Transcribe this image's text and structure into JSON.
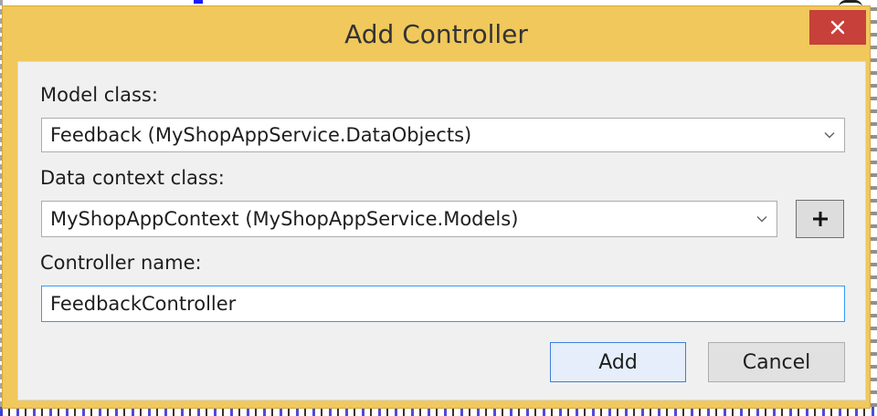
{
  "window": {
    "title": "Add Controller",
    "close_icon": "close-icon"
  },
  "form": {
    "model_class": {
      "label": "Model class:",
      "value": "Feedback (MyShopAppService.DataObjects)"
    },
    "data_context_class": {
      "label": "Data context class:",
      "value": "MyShopAppContext (MyShopAppService.Models)",
      "add_icon": "plus-icon"
    },
    "controller_name": {
      "label": "Controller name:",
      "value": "FeedbackController"
    }
  },
  "buttons": {
    "add_label": "Add",
    "cancel_label": "Cancel"
  },
  "colors": {
    "title_bar": "#f0c85c",
    "close_button": "#c7403a",
    "focus_border": "#3399ff",
    "client_background": "#f0f0f0"
  }
}
